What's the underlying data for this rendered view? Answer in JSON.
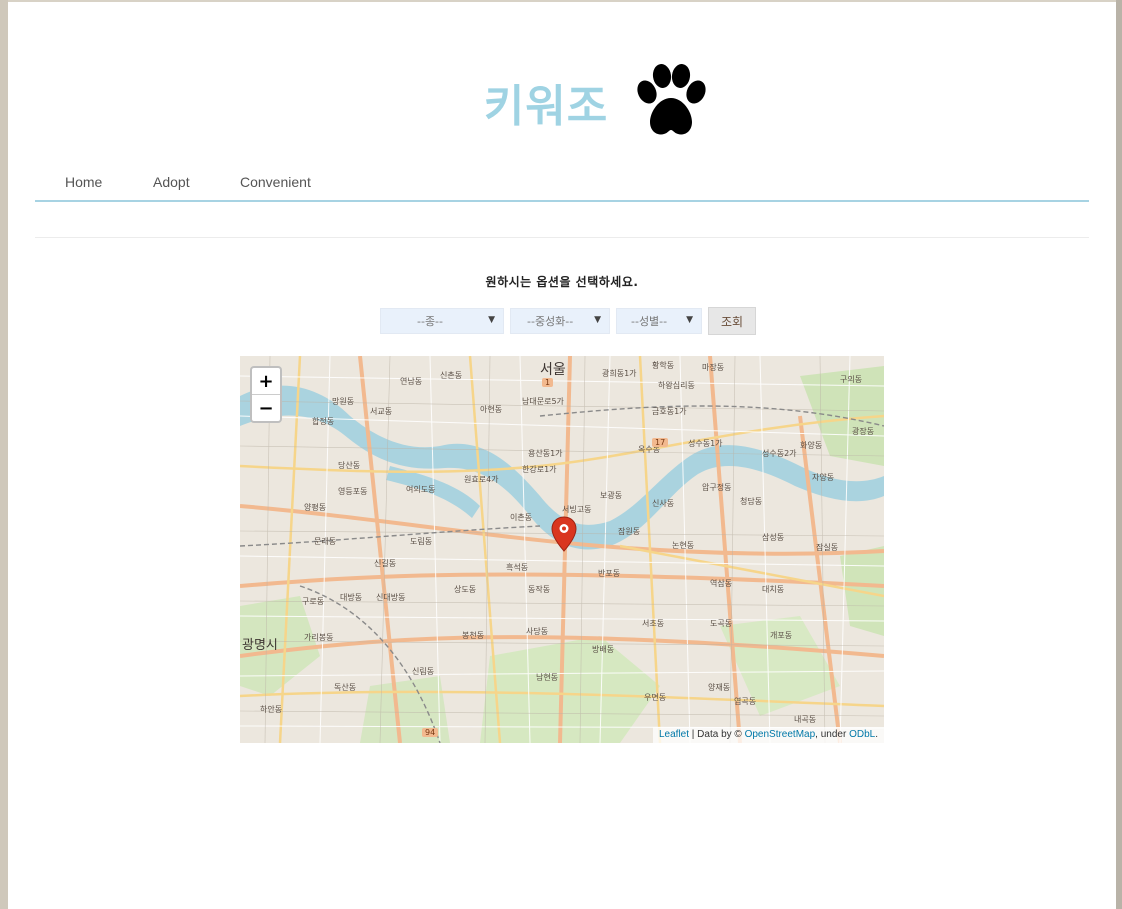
{
  "brand": {
    "title": "키워조",
    "logo_icon": "paw-icon"
  },
  "nav": {
    "items": [
      "Home",
      "Adopt",
      "Convenient"
    ]
  },
  "prompt": "원하시는 옵션을 선택하세요.",
  "filters": {
    "species": "--종--",
    "neutered": "--중성화--",
    "sex": "--성별--",
    "search_button": "조회"
  },
  "map": {
    "zoom_in": "+",
    "zoom_out": "−",
    "attribution": {
      "leaflet": "Leaflet",
      "data_by": " | Data by © ",
      "osm": "OpenStreetMap",
      "under": ", under ",
      "odbl": "ODbL",
      "end": "."
    },
    "labels": [
      "서울",
      "광명시",
      "신촌동",
      "연남동",
      "망원동",
      "서교동",
      "합정동",
      "아현동",
      "남대문로5가",
      "광희동1가",
      "황학동",
      "하왕십리동",
      "마장동",
      "금호동1가",
      "성수동1가",
      "성수동2가",
      "자양동",
      "구의동",
      "광장동",
      "화양동",
      "한강로1가",
      "용산동1가",
      "보광동",
      "압구정동",
      "청담동",
      "삼성동",
      "잠실동",
      "신사동",
      "논현동",
      "역삼동",
      "대치동",
      "도곡동",
      "서초동",
      "개포동",
      "반포동",
      "흑석동",
      "동작동",
      "사당동",
      "방배동",
      "상도동",
      "대방동",
      "신대방동",
      "구로동",
      "가리봉동",
      "독산동",
      "신림동",
      "봉천동",
      "남현동",
      "양재동",
      "내곡동",
      "여의도동",
      "영등포동",
      "당산동",
      "양평동",
      "문래동",
      "도림동",
      "신길동",
      "원효로4가",
      "이촌동",
      "서빙고동",
      "옥수동",
      "잠원동",
      "우면동",
      "염곡동",
      "하안동"
    ],
    "road_badges": [
      "94",
      "17",
      "1"
    ]
  },
  "colors": {
    "brand": "#9fd3e3",
    "nav_border": "#a7d3e3",
    "select_bg": "#e9f1fb",
    "marker": "#d9361f",
    "river": "#aad3df"
  }
}
